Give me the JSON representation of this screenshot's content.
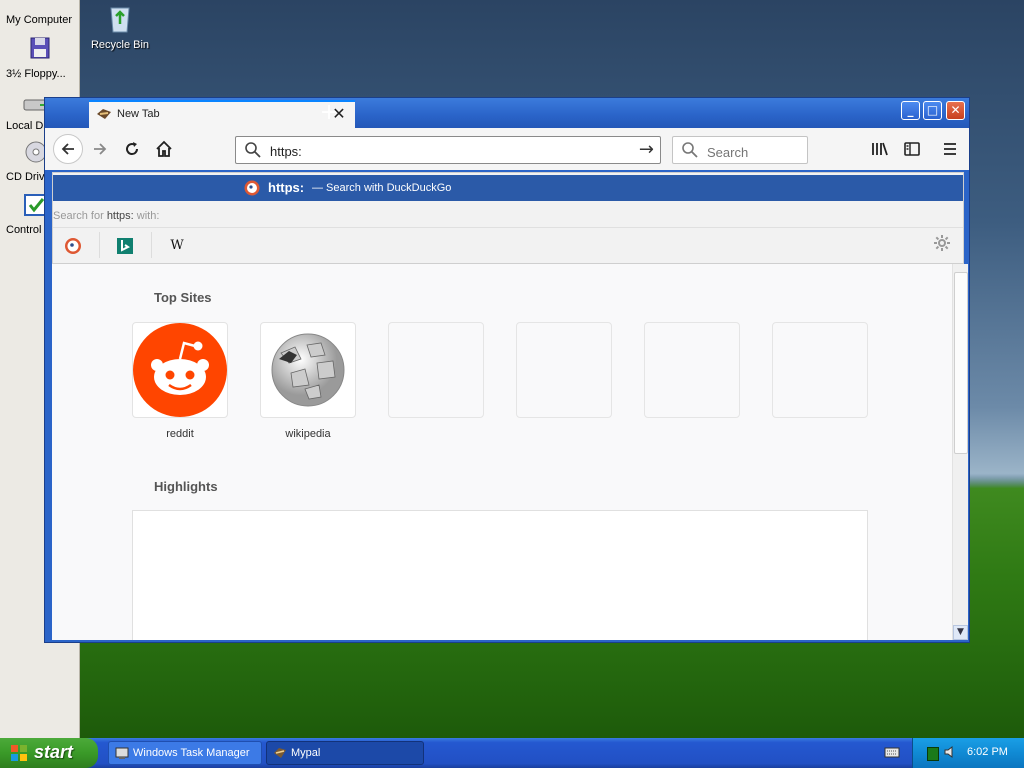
{
  "desktop": {
    "items": [
      {
        "label": "My Computer"
      },
      {
        "label": "3½ Floppy..."
      },
      {
        "label": "Local Di"
      },
      {
        "label": "CD Drive"
      },
      {
        "label": "Control"
      }
    ],
    "recycle_bin": "Recycle Bin"
  },
  "browser": {
    "tab_title": "New Tab",
    "tab_close": "✕",
    "new_tab": "+",
    "window_controls": {
      "minimize": "_",
      "maximize": "□",
      "close": "✕"
    },
    "url_value": "https:",
    "search_placeholder": "Search",
    "dropdown": {
      "suggestion_query": "https:",
      "suggestion_action": "— Search with DuckDuckGo",
      "search_for_prefix": "Search for",
      "search_for_query": "https:",
      "search_for_suffix": "with:",
      "engines": [
        "duckduckgo-icon",
        "bing-icon",
        "wikipedia-icon"
      ],
      "wikipedia_glyph": "W"
    },
    "newtab": {
      "top_sites_title": "Top Sites",
      "top_sites": [
        {
          "label": "reddit"
        },
        {
          "label": "wikipedia"
        }
      ],
      "highlights_title": "Highlights"
    }
  },
  "taskbar": {
    "start_label": "start",
    "tasks": [
      {
        "label": "Windows Task Manager"
      },
      {
        "label": "Mypal"
      }
    ],
    "clock": "6:02 PM"
  },
  "colors": {
    "accent": "#0a84ff",
    "suggestion_bg": "#2b5aa8",
    "reddit": "#ff4500",
    "xp_blue": "#2458d0",
    "start_green": "#3a9a28"
  }
}
